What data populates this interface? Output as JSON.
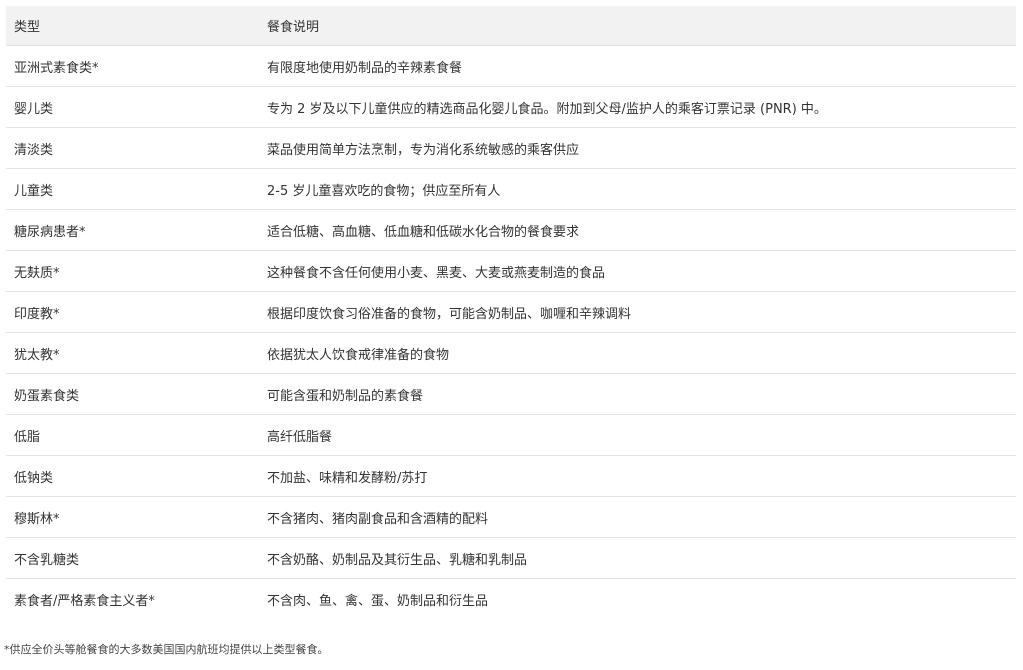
{
  "table": {
    "headers": [
      "类型",
      "餐食说明"
    ],
    "rows": [
      [
        "亚洲式素食类*",
        "有限度地使用奶制品的辛辣素食餐"
      ],
      [
        "婴儿类",
        "专为 2 岁及以下儿童供应的精选商品化婴儿食品。附加到父母/监护人的乘客订票记录 (PNR) 中。"
      ],
      [
        "清淡类",
        "菜品使用简单方法烹制，专为消化系统敏感的乘客供应"
      ],
      [
        "儿童类",
        "2-5 岁儿童喜欢吃的食物；供应至所有人"
      ],
      [
        "糖尿病患者*",
        "适合低糖、高血糖、低血糖和低碳水化合物的餐食要求"
      ],
      [
        "无麸质*",
        "这种餐食不含任何使用小麦、黑麦、大麦或燕麦制造的食品"
      ],
      [
        "印度教*",
        "根据印度饮食习俗准备的食物，可能含奶制品、咖喱和辛辣调料"
      ],
      [
        "犹太教*",
        "依据犹太人饮食戒律准备的食物"
      ],
      [
        "奶蛋素食类",
        "可能含蛋和奶制品的素食餐"
      ],
      [
        "低脂",
        "高纤低脂餐"
      ],
      [
        "低钠类",
        "不加盐、味精和发酵粉/苏打"
      ],
      [
        "穆斯林*",
        "不含猪肉、猪肉副食品和含酒精的配料"
      ],
      [
        "不含乳糖类",
        "不含奶酪、奶制品及其衍生品、乳糖和乳制品"
      ],
      [
        "素食者/严格素食主义者*",
        "不含肉、鱼、禽、蛋、奶制品和衍生品"
      ]
    ]
  },
  "footnote": "*供应全价头等舱餐食的大多数美国国内航班均提供以上类型餐食。"
}
